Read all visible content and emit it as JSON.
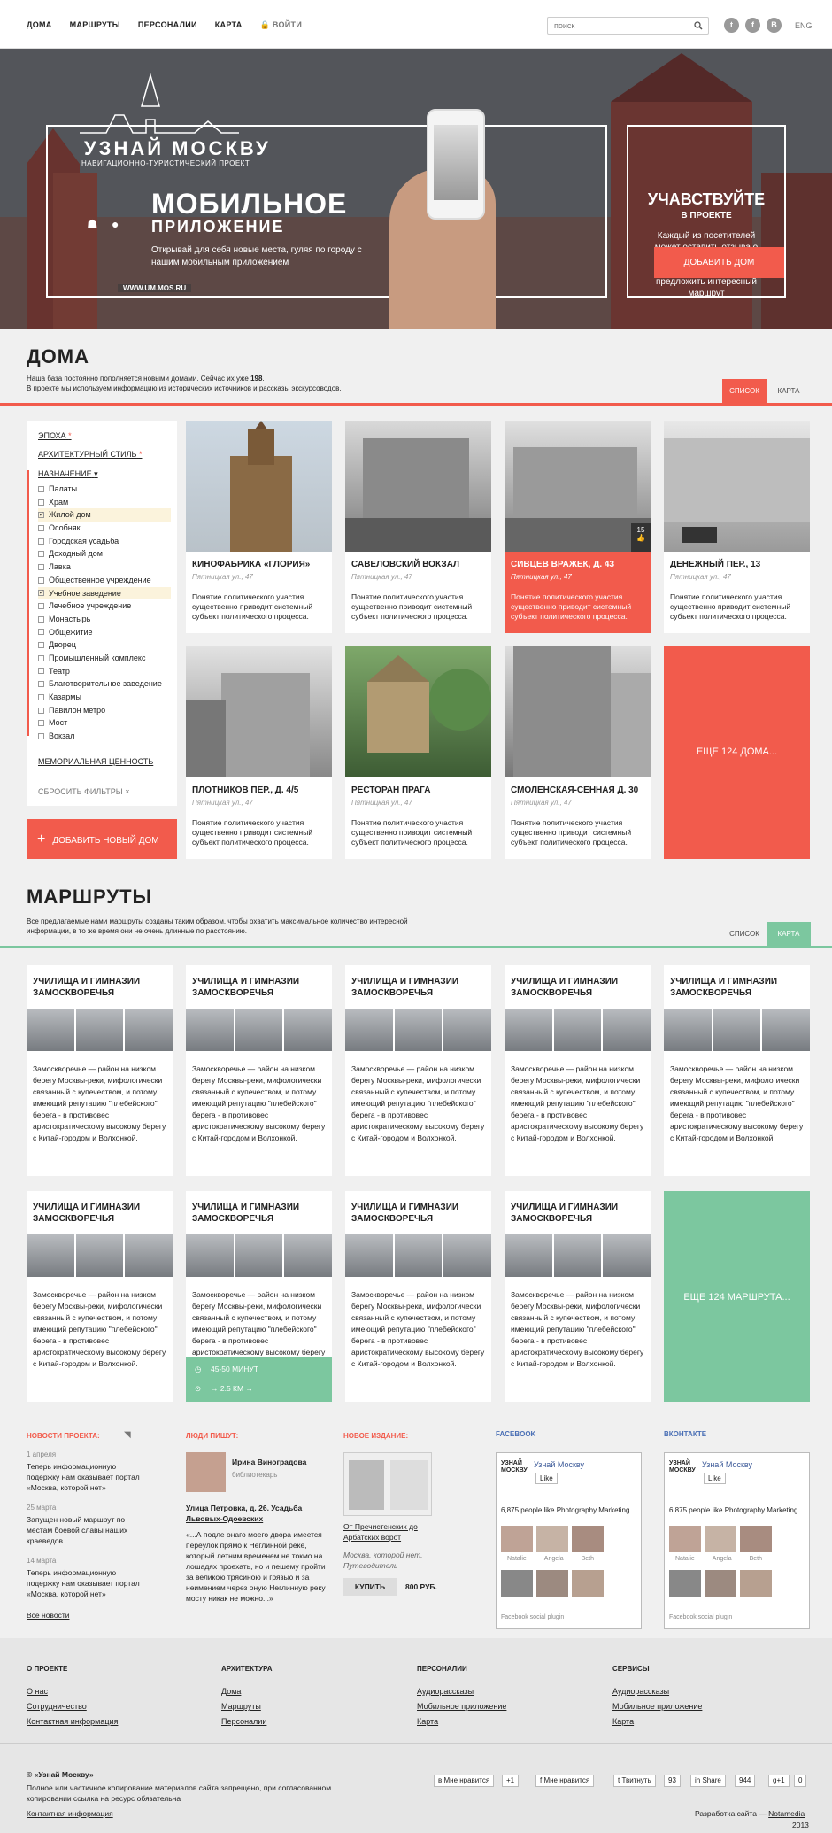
{
  "nav": {
    "items": [
      "ДОМА",
      "МАРШРУТЫ",
      "ПЕРСОНАЛИИ",
      "КАРТА"
    ],
    "login": "ВОЙТИ",
    "search_placeholder": "поиск",
    "lang": "ENG"
  },
  "hero": {
    "brand": "УЗНАЙ МОСКВУ",
    "brand_sub": "НАВИГАЦИОННО-ТУРИСТИЧЕСКИЙ ПРОЕКТ",
    "title1": "МОБИЛЬНОЕ",
    "title2": "ПРИЛОЖЕНИЕ",
    "text": "Открывай для себя новые места, гуляя по городу с нашим мобильным приложением",
    "url": "WWW.UM.MOS.RU",
    "participate_title": "УЧАВСТВУЙТЕ",
    "participate_sub": "В ПРОЕКТЕ",
    "participate_text": "Каждый из посетителей может оставить отзыва о том или ином доме, написать обзор или предложить интересный маршрут",
    "add_button": "ДОБАВИТЬ ДОМ"
  },
  "houses": {
    "title": "ДОМА",
    "desc1": "Наша база постоянно пополняется новыми домами. Сейчас их уже ",
    "count": "198",
    "desc2": "В проекте мы используем информацию из исторических источников и рассказы экскурсоводов.",
    "tab_list": "СПИСОК",
    "tab_map": "КАРТА",
    "filters": {
      "epoch": "ЭПОХА",
      "style": "АРХИТЕКТУРНЫЙ СТИЛЬ",
      "purpose": "НАЗНАЧЕНИЕ",
      "options": [
        "Палаты",
        "Храм",
        "Жилой дом",
        "Особняк",
        "Городская усадьба",
        "Доходный дом",
        "Лавка",
        "Общественное учреждение",
        "Учебное заведение",
        "Лечебное учреждение",
        "Монастырь",
        "Общежитие",
        "Дворец",
        "Промышленный комплекс",
        "Театр",
        "Благотворительное заведение",
        "Казармы",
        "Павилон метро",
        "Мост",
        "Вокзал"
      ],
      "memorial": "МЕМОРИАЛЬНАЯ ЦЕННОСТЬ",
      "reset": "СБРОСИТЬ ФИЛЬТРЫ"
    },
    "add_new": "ДОБАВИТЬ НОВЫЙ ДОМ",
    "cards": [
      {
        "title": "КИНОФАБРИКА «ГЛОРИЯ»",
        "addr": "Пятницкая ул., 47",
        "desc": "Понятие политического участия существенно приводит системный субъект политического процесса."
      },
      {
        "title": "САВЕЛОВСКИЙ ВОКЗАЛ",
        "addr": "Пятницкая ул., 47",
        "desc": "Понятие политического участия существенно приводит системный субъект политического процесса."
      },
      {
        "title": "СИВЦЕВ ВРАЖЕК, Д. 43",
        "addr": "Пятницкая ул., 47",
        "desc": "Понятие политического участия существенно приводит системный субъект политического процесса.",
        "likes": "15"
      },
      {
        "title": "ДЕНЕЖНЫЙ ПЕР., 13",
        "addr": "Пятницкая ул., 47",
        "desc": "Понятие политического участия существенно приводит системный субъект политического процесса."
      },
      {
        "title": "ПЛОТНИКОВ ПЕР., Д. 4/5",
        "addr": "Пятницкая ул., 47",
        "desc": "Понятие политического участия существенно приводит системный субъект политического процесса."
      },
      {
        "title": "РЕСТОРАН ПРАГА",
        "addr": "Пятницкая ул., 47",
        "desc": "Понятие политического участия существенно приводит системный субъект политического процесса."
      },
      {
        "title": "СМОЛЕНСКАЯ-СЕННАЯ Д. 30",
        "addr": "Пятницкая ул., 47",
        "desc": "Понятие политического участия существенно приводит системный субъект политического процесса."
      }
    ],
    "more": "ЕЩЕ 124 ДОМА..."
  },
  "routes": {
    "title": "МАРШРУТЫ",
    "desc": "Все предлагаемые нами маршруты созданы таким образом, чтобы охватить максимальное количество интересной информации, в то же время они не очень длинные по расстоянию.",
    "tab_list": "СПИСОК",
    "tab_map": "КАРТА",
    "card_title": "УЧИЛИЩА И ГИМНАЗИИ ЗАМОСКВОРЕЧЬЯ",
    "card_desc": "Замоскворечье — район на низком берегу Москвы-реки, мифологически связанный с купечеством, и потому имеющий репутацию \"плебейского\" берега - в противовес аристократическому высокому берегу с Китай-городом и Волхонкой.",
    "time": "45-50 МИНУТ",
    "dist": "→ 2.5 КМ →",
    "more": "ЕЩЕ 124 МАРШРУТА..."
  },
  "news": {
    "title": "НОВОСТИ ПРОЕКТА:",
    "items": [
      {
        "date": "1 апреля",
        "text": "Теперь информационную подержку нам оказывает портал «Москва, которой нет»"
      },
      {
        "date": "25 марта",
        "text": "Запущен новый маршрут по местам боевой славы наших краеведов"
      },
      {
        "date": "14 марта",
        "text": "Теперь информационную подержку нам оказывает портал «Москва, которой нет»"
      }
    ],
    "all": "Все новости"
  },
  "people": {
    "title": "ЛЮДИ ПИШУТ:",
    "name": "Ирина Виноградова",
    "role": "библиотекарь",
    "link": "Улица Петровка, д. 26. Усадьба Львовых-Одоевских",
    "text": "«...А подле онаго моего двора имеется переулок прямо к Неглинной реке, который летним временем не токмо на лошадях проехать, но и пешему пройти за великою трясиною и грязью и за неимением через оную Неглинную реку мосту никак не можно...»"
  },
  "book": {
    "title": "НОВОЕ ИЗДАНИЕ:",
    "link": "От Пречистенских до Арбатских ворот",
    "sub": "Москва, которой нет. Путеводитель",
    "buy": "КУПИТЬ",
    "price": "800 РУБ."
  },
  "facebook": {
    "title": "FACEBOOK",
    "name": "Узнай Москву",
    "like": "Like",
    "count": "6,875 people like Photography Marketing.",
    "people": [
      "Natalie",
      "Angela",
      "Beth"
    ],
    "plugin": "Facebook social plugin"
  },
  "vk": {
    "title": "ВКОНТАКТЕ",
    "name": "Узнай Москву",
    "like": "Like",
    "count": "6,875 people like Photography Marketing.",
    "people": [
      "Natalie",
      "Angela",
      "Beth"
    ],
    "plugin": "Facebook social plugin"
  },
  "footer": {
    "cols": [
      {
        "title": "О ПРОЕКТЕ",
        "links": [
          "О нас",
          "Сотрудничество",
          "Контактная информация"
        ]
      },
      {
        "title": "АРХИТЕКТУРА",
        "links": [
          "Дома",
          "Маршруты",
          "Персоналии"
        ]
      },
      {
        "title": "ПЕРСОНАЛИИ",
        "links": [
          "Аудиорассказы",
          "Мобильное приложение",
          "Карта"
        ]
      },
      {
        "title": "СЕРВИСЫ",
        "links": [
          "Аудиорассказы",
          "Мобильное приложение",
          "Карта"
        ]
      }
    ],
    "copyright": "© «Узнай Москву»",
    "legal": "Полное или частичное копирование материалов сайта запрещено, при согласованном копировании ссылка на ресурс обязательна",
    "contact": "Контактная информация",
    "dev": "Разработка сайта — ",
    "dev_link": "Notamedia",
    "year": "2013",
    "share": {
      "vk": "Мне нравится",
      "g1": "+1",
      "fb": "Мне нравится",
      "tw": "Твитнуть",
      "tw_n": "93",
      "in": "Share",
      "in_n": "944",
      "gp": "+1",
      "gp_n": "0"
    }
  }
}
